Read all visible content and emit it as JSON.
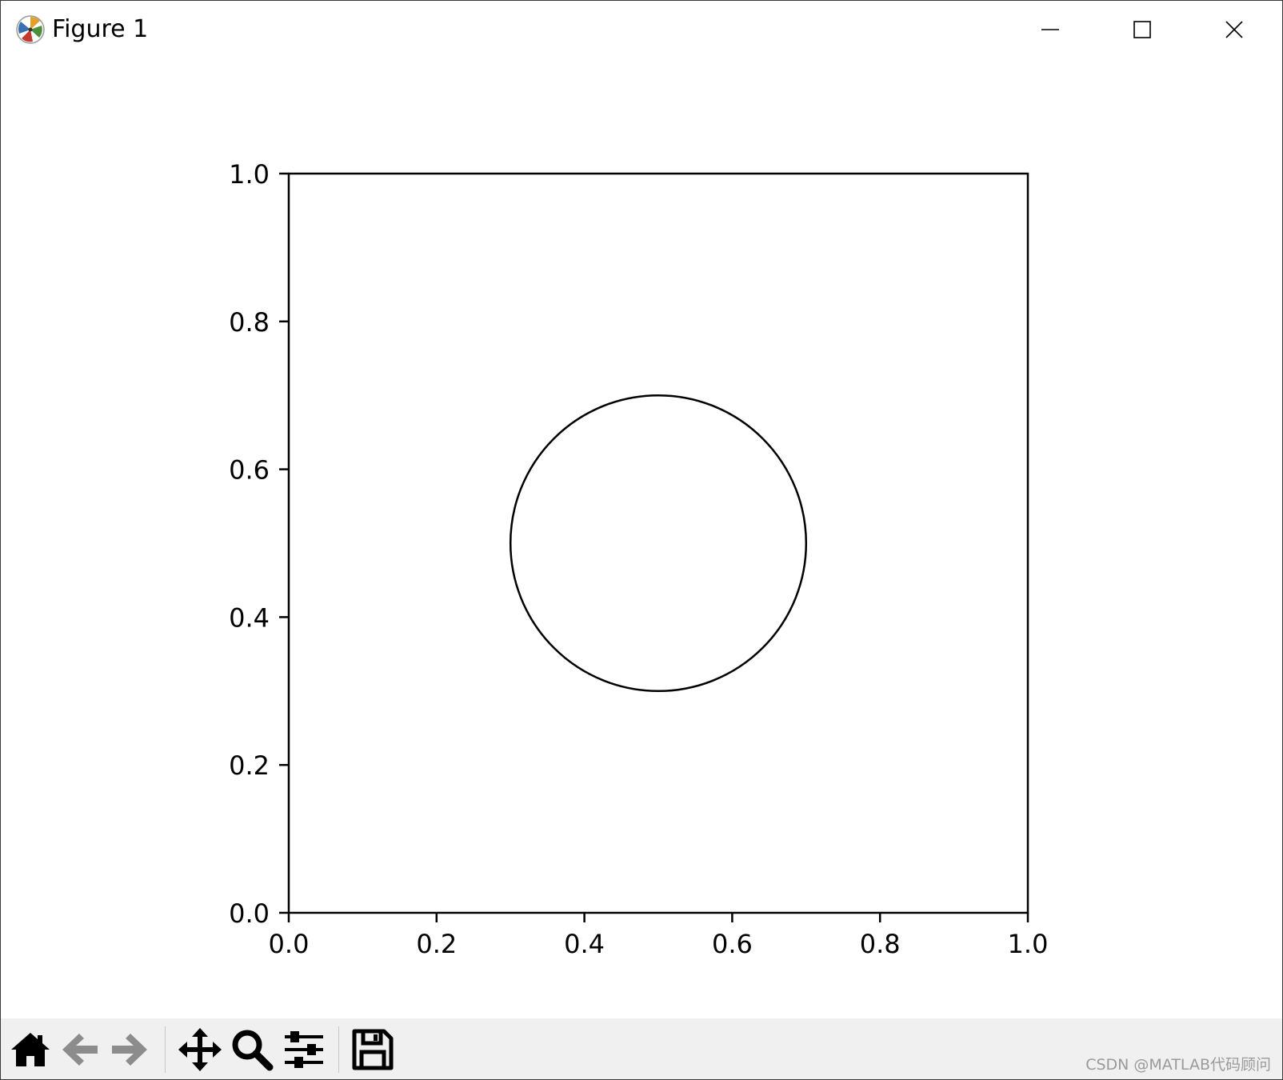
{
  "window": {
    "title": "Figure 1",
    "controls": {
      "minimize": "minimize-icon",
      "maximize": "maximize-icon",
      "close": "close-icon"
    }
  },
  "chart_data": {
    "type": "scatter",
    "title": "",
    "xlabel": "",
    "ylabel": "",
    "xlim": [
      0.0,
      1.0
    ],
    "ylim": [
      0.0,
      1.0
    ],
    "grid": false,
    "x_ticks": [
      "0.0",
      "0.2",
      "0.4",
      "0.6",
      "0.8",
      "1.0"
    ],
    "y_ticks": [
      "0.0",
      "0.2",
      "0.4",
      "0.6",
      "0.8",
      "1.0"
    ],
    "shapes": [
      {
        "kind": "circle",
        "center": [
          0.5,
          0.5
        ],
        "radius": 0.2,
        "fill": "none",
        "edge_color": "#000000"
      }
    ]
  },
  "toolbar": {
    "tools": [
      {
        "name": "home-icon"
      },
      {
        "name": "back-arrow-icon"
      },
      {
        "name": "forward-arrow-icon"
      },
      {
        "name": "pan-icon"
      },
      {
        "name": "zoom-icon"
      },
      {
        "name": "configure-subplots-icon"
      },
      {
        "name": "save-icon"
      }
    ]
  },
  "watermark": "CSDN @MATLAB代码顾问"
}
